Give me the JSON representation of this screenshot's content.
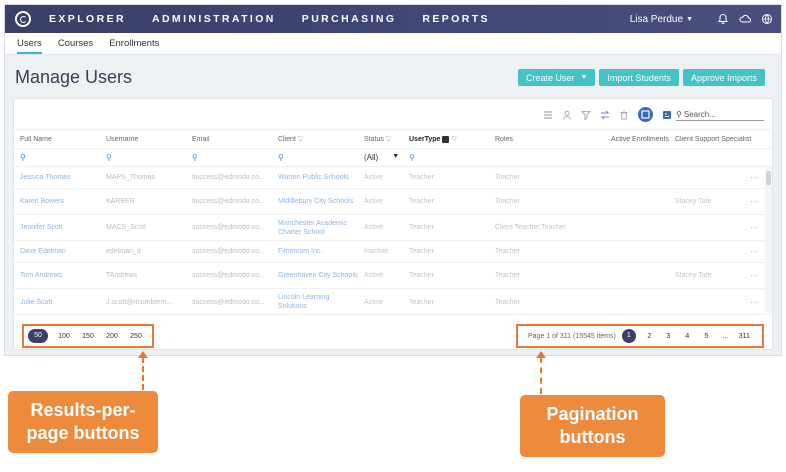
{
  "nav": {
    "links": [
      "EXPLORER",
      "ADMINISTRATION",
      "PURCHASING",
      "REPORTS"
    ],
    "user": "Lisa Perdue",
    "icons": [
      "bell-icon",
      "cloud-icon",
      "globe-icon"
    ]
  },
  "subtabs": [
    "Users",
    "Courses",
    "Enrollments"
  ],
  "page": {
    "title": "Manage Users",
    "create_user": "Create User",
    "import_students": "Import Students",
    "approve_imports": "Approve Imports"
  },
  "search": {
    "placeholder": "Search..."
  },
  "columns": {
    "full_name": "Full Name",
    "username": "Username",
    "email": "Email",
    "client": "Client",
    "status": "Status",
    "usertype": "UserType",
    "roles": "Roles",
    "active_enrollments": "Active Enrollments",
    "client_support": "Client Support Specialist"
  },
  "filters": {
    "status_value": "(All)"
  },
  "rows": [
    {
      "name": "Jessica Thomas",
      "username": "MAPS_Thomas",
      "email": "success@edmodo.co...",
      "client": "Warren Public Schools",
      "status": "Active",
      "type": "Teacher",
      "roles": "Teacher",
      "css": ""
    },
    {
      "name": "Karen Bowers",
      "username": "KARBER",
      "email": "success@edmodo.co...",
      "client": "Middlebury City Schools",
      "status": "Active",
      "type": "Teacher",
      "roles": "Teacher",
      "css": "Stacey Tate"
    },
    {
      "name": "Jennifer Scott",
      "username": "MACS_Scott",
      "email": "success@edmodo.co...",
      "client": "Manchester Academic Charter School",
      "status": "Active",
      "type": "Teacher",
      "roles": "Client Teacher,Teacher",
      "css": ""
    },
    {
      "name": "Dave Edelman",
      "username": "edelman_d",
      "email": "success@edmodo.co...",
      "client": "Fitnercom Inc.",
      "status": "Inactive",
      "type": "Teacher",
      "roles": "Teacher",
      "css": ""
    },
    {
      "name": "Tom Andrews",
      "username": "TAndrews",
      "email": "success@edmodo.co...",
      "client": "Greenhaven City Schools",
      "status": "Active",
      "type": "Teacher",
      "roles": "Teacher",
      "css": "Stacey Tate"
    },
    {
      "name": "Julie Scott",
      "username": "J.scott@ricumberm...",
      "email": "success@edmodo.co...",
      "client": "Lincoln Learning Solutions",
      "status": "Active",
      "type": "Teacher",
      "roles": "Teacher",
      "css": ""
    }
  ],
  "per_page": [
    "50",
    "100",
    "150",
    "200",
    "250"
  ],
  "per_page_selected": "50",
  "pagination": {
    "info": "Page 1 of 311 (15545 items)",
    "pages": [
      "1",
      "2",
      "3",
      "4",
      "5",
      "...",
      "311"
    ],
    "current": "1"
  },
  "callouts": {
    "per_page_label": "Results-per-page buttons",
    "pagination_label": "Pagination buttons"
  },
  "colors": {
    "nav_bg": "#3a3f66",
    "teal": "#45c3c4",
    "accent_orange": "#e9772f",
    "link_blue": "#3b69b1"
  }
}
